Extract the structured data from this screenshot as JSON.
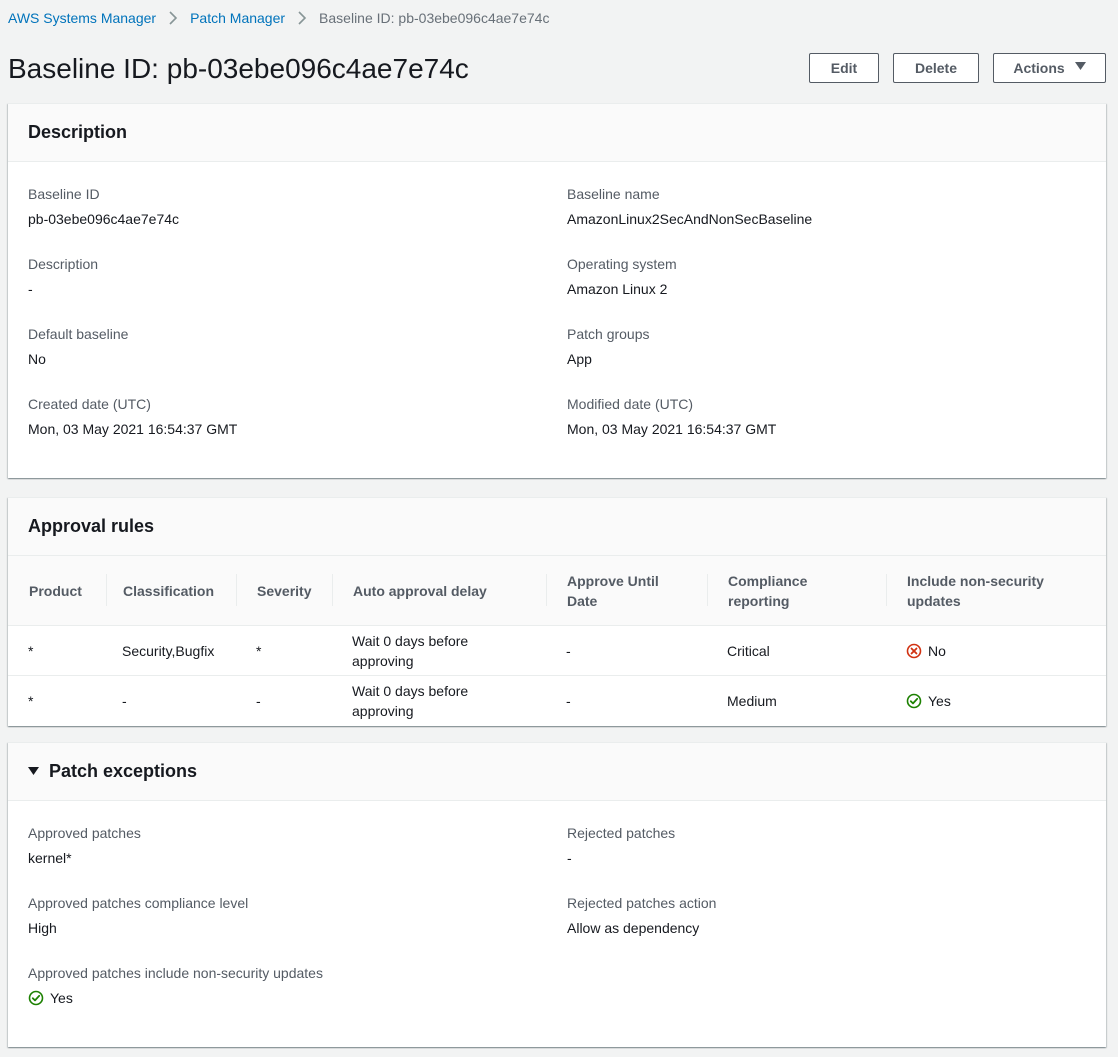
{
  "breadcrumb": {
    "item1": "AWS Systems Manager",
    "item2": "Patch Manager",
    "current": "Baseline ID: pb-03ebe096c4ae7e74c"
  },
  "header": {
    "title": "Baseline ID: pb-03ebe096c4ae7e74c",
    "edit_label": "Edit",
    "delete_label": "Delete",
    "actions_label": "Actions"
  },
  "description": {
    "title": "Description",
    "baseline_id_label": "Baseline ID",
    "baseline_id": "pb-03ebe096c4ae7e74c",
    "baseline_name_label": "Baseline name",
    "baseline_name": "AmazonLinux2SecAndNonSecBaseline",
    "description_label": "Description",
    "description": "-",
    "os_label": "Operating system",
    "os": "Amazon Linux 2",
    "default_label": "Default baseline",
    "default": "No",
    "patch_groups_label": "Patch groups",
    "patch_groups": "App",
    "created_label": "Created date (UTC)",
    "created": "Mon, 03 May 2021 16:54:37 GMT",
    "modified_label": "Modified date (UTC)",
    "modified": "Mon, 03 May 2021 16:54:37 GMT"
  },
  "approval_rules": {
    "title": "Approval rules",
    "columns": {
      "product": "Product",
      "classification": "Classification",
      "severity": "Severity",
      "delay": "Auto approval delay",
      "until1": "Approve Until",
      "until2": "Date",
      "compliance1": "Compliance",
      "compliance2": "reporting",
      "nonsec1": "Include non-security",
      "nonsec2": "updates"
    },
    "rows": [
      {
        "product": "*",
        "classification": "Security,Bugfix",
        "severity": "*",
        "delay1": "Wait 0 days before",
        "delay2": "approving",
        "until": "-",
        "compliance": "Critical",
        "nonsec": "No",
        "nonsec_status": "error"
      },
      {
        "product": "*",
        "classification": "-",
        "severity": "-",
        "delay1": "Wait 0 days before",
        "delay2": "approving",
        "until": "-",
        "compliance": "Medium",
        "nonsec": "Yes",
        "nonsec_status": "success"
      }
    ]
  },
  "patch_exceptions": {
    "title": "Patch exceptions",
    "approved_label": "Approved patches",
    "approved": "kernel*",
    "rejected_label": "Rejected patches",
    "rejected": "-",
    "approved_compliance_label": "Approved patches compliance level",
    "approved_compliance": "High",
    "rejected_action_label": "Rejected patches action",
    "rejected_action": "Allow as dependency",
    "include_nonsec_label": "Approved patches include non-security updates",
    "include_nonsec": "Yes"
  },
  "colors": {
    "link": "#0073bb",
    "success": "#1d8102",
    "error": "#d13212"
  }
}
